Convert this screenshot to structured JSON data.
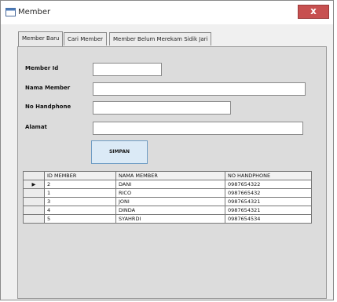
{
  "window": {
    "title": "Member",
    "close_glyph": "x"
  },
  "tabs": [
    {
      "label": "Member Baru"
    },
    {
      "label": "Cari Member"
    },
    {
      "label": "Member Belum Merekam Sidik Jari"
    }
  ],
  "form": {
    "member_id_label": "Member Id",
    "nama_label": "Nama Member",
    "phone_label": "No Handphone",
    "alamat_label": "Alamat",
    "member_id_value": "",
    "nama_value": "",
    "phone_value": "",
    "alamat_value": "",
    "save_label": "SIMPAN"
  },
  "table": {
    "columns": [
      "ID MEMBER",
      "NAMA MEMBER",
      "NO HANDPHONE"
    ],
    "current_row_marker": "▶",
    "rows": [
      [
        "2",
        "DANI",
        "0987654322"
      ],
      [
        "1",
        "RICO",
        "0987665432"
      ],
      [
        "3",
        "JONI",
        "0987654321"
      ],
      [
        "4",
        "DINDA",
        "0987654321"
      ],
      [
        "5",
        "SYAHRDI",
        "0987654534"
      ]
    ]
  },
  "icons": {
    "app": "window-app-icon",
    "row_pointer": "triangle-right-icon"
  }
}
